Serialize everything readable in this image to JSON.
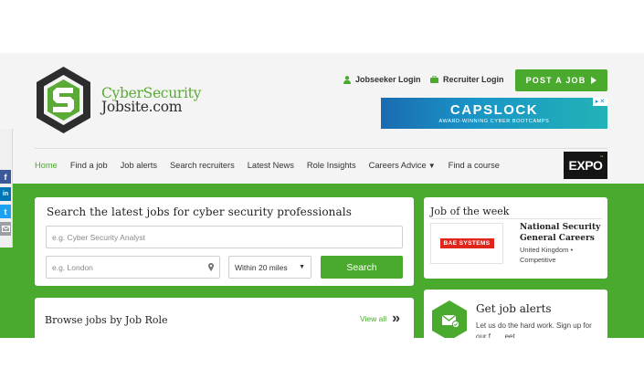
{
  "brand": {
    "line1": "CyberSecurity",
    "line2": "Jobsite.com",
    "green": "#4aaa2e"
  },
  "header": {
    "jobseeker_login": "Jobseeker Login",
    "recruiter_login": "Recruiter Login",
    "post_job": "POST A JOB"
  },
  "ad": {
    "title": "CAPSLOCK",
    "subtitle": "AWARD-WINNING CYBER BOOTCAMPS"
  },
  "nav": {
    "items": [
      "Home",
      "Find a job",
      "Job alerts",
      "Search recruiters",
      "Latest News",
      "Role Insights",
      "Careers Advice",
      "Find a course"
    ],
    "expo": "EXPO"
  },
  "social": [
    "f",
    "in",
    "t",
    "mail"
  ],
  "search": {
    "title": "Search the latest jobs for cyber security professionals",
    "keyword_placeholder": "e.g. Cyber Security Analyst",
    "location_placeholder": "e.g. London",
    "radius": "Within 20 miles",
    "button": "Search"
  },
  "browse": {
    "title": "Browse jobs by Job Role",
    "view_all": "View all"
  },
  "job_of_week": {
    "title": "Job of the week",
    "company_logo_text": "BAE SYSTEMS",
    "job_title": "National Security General Careers",
    "location": "United Kingdom •",
    "salary": "Competitive"
  },
  "alerts": {
    "title": "Get job alerts",
    "text": "Let us do the hard work. Sign up for our f... ...eet"
  }
}
